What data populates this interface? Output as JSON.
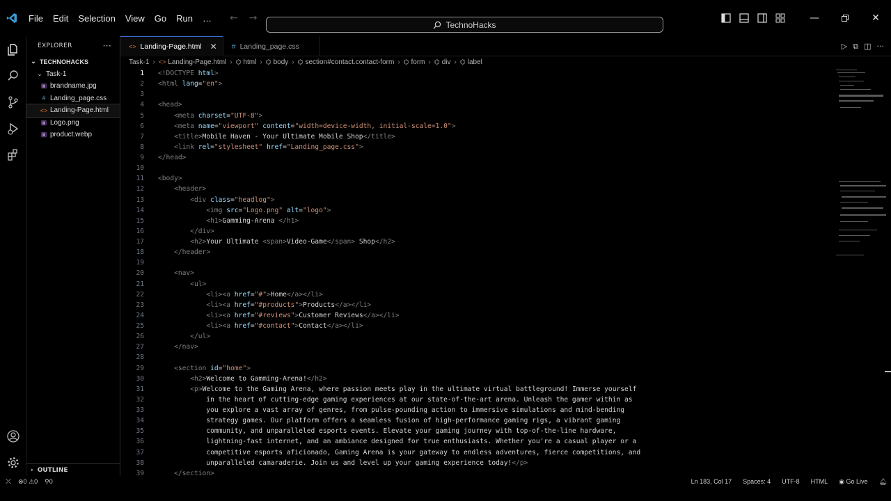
{
  "titlebar": {
    "menu": [
      "File",
      "Edit",
      "Selection",
      "View",
      "Go",
      "Run",
      "…"
    ],
    "search_text": "TechnoHacks"
  },
  "sidebar": {
    "header": "EXPLORER",
    "root": "TECHNOHACKS",
    "folder": "Task-1",
    "files": [
      {
        "name": "brandname.jpg",
        "icon": "image-icon"
      },
      {
        "name": "Landing_page.css",
        "icon": "css-icon"
      },
      {
        "name": "Landing-Page.html",
        "icon": "html-icon",
        "selected": true
      },
      {
        "name": "Logo.png",
        "icon": "image-icon"
      },
      {
        "name": "product.webp",
        "icon": "image-icon"
      }
    ],
    "outline_label": "OUTLINE"
  },
  "tabs": [
    {
      "label": "Landing-Page.html",
      "active": true
    },
    {
      "label": "Landing_page.css",
      "active": false
    }
  ],
  "breadcrumbs": [
    "Task-1",
    "Landing-Page.html",
    "html",
    "body",
    "section#contact.contact-form",
    "form",
    "div",
    "label"
  ],
  "code_lines": [
    {
      "n": "1",
      "text": "<!DOCTYPE html>"
    },
    {
      "n": "2",
      "text": "<html lang=\"en\">"
    },
    {
      "n": "3",
      "text": ""
    },
    {
      "n": "4",
      "text": "<head>"
    },
    {
      "n": "5",
      "text": "    <meta charset=\"UTF-8\">"
    },
    {
      "n": "6",
      "text": "    <meta name=\"viewport\" content=\"width=device-width, initial-scale=1.0\">"
    },
    {
      "n": "7",
      "text": "    <title>Mobile Haven - Your Ultimate Mobile Shop</title>"
    },
    {
      "n": "8",
      "text": "    <link rel=\"stylesheet\" href=\"Landing_page.css\">"
    },
    {
      "n": "9",
      "text": "</head>"
    },
    {
      "n": "10",
      "text": ""
    },
    {
      "n": "11",
      "text": "<body>"
    },
    {
      "n": "12",
      "text": "    <header>"
    },
    {
      "n": "13",
      "text": "        <div class=\"headlog\">"
    },
    {
      "n": "14",
      "text": "            <img src=\"Logo.png\" alt=\"logo\">"
    },
    {
      "n": "15",
      "text": "            <h1>Gamming-Arena </h1>"
    },
    {
      "n": "16",
      "text": "        </div>"
    },
    {
      "n": "17",
      "text": "        <h2>Your Ultimate <span>Video-Game</span> Shop</h2>"
    },
    {
      "n": "18",
      "text": "    </header>"
    },
    {
      "n": "19",
      "text": ""
    },
    {
      "n": "20",
      "text": "    <nav>"
    },
    {
      "n": "21",
      "text": "        <ul>"
    },
    {
      "n": "22",
      "text": "            <li><a href=\"#\">Home</a></li>"
    },
    {
      "n": "23",
      "text": "            <li><a href=\"#products\">Products</a></li>"
    },
    {
      "n": "24",
      "text": "            <li><a href=\"#reviews\">Customer Reviews</a></li>"
    },
    {
      "n": "25",
      "text": "            <li><a href=\"#contact\">Contact</a></li>"
    },
    {
      "n": "26",
      "text": "        </ul>"
    },
    {
      "n": "27",
      "text": "    </nav>"
    },
    {
      "n": "28",
      "text": ""
    },
    {
      "n": "29",
      "text": "    <section id=\"home\">"
    },
    {
      "n": "30",
      "text": "        <h2>Welcome to Gamming-Arena!</h2>"
    },
    {
      "n": "31",
      "text": "        <p>Welcome to the Gaming Arena, where passion meets play in the ultimate virtual battleground! Immerse yourself"
    },
    {
      "n": "32",
      "text": "            in the heart of cutting-edge gaming experiences at our state-of-the-art arena. Unleash the gamer within as"
    },
    {
      "n": "33",
      "text": "            you explore a vast array of genres, from pulse-pounding action to immersive simulations and mind-bending"
    },
    {
      "n": "34",
      "text": "            strategy games. Our platform offers a seamless fusion of high-performance gaming rigs, a vibrant gaming"
    },
    {
      "n": "35",
      "text": "            community, and unparalleled esports events. Elevate your gaming journey with top-of-the-line hardware,"
    },
    {
      "n": "36",
      "text": "            lightning-fast internet, and an ambiance designed for true enthusiasts. Whether you're a casual player or a"
    },
    {
      "n": "37",
      "text": "            competitive esports aficionado, Gaming Arena is your gateway to endless adventures, fierce competitions, and"
    },
    {
      "n": "38",
      "text": "            unparalleled camaraderie. Join us and level up your gaming experience today!</p>"
    },
    {
      "n": "39",
      "text": "    </section>"
    }
  ],
  "status": {
    "errors": "0",
    "warnings": "0",
    "ports": "0",
    "position": "Ln 183, Col 17",
    "spaces": "Spaces: 4",
    "encoding": "UTF-8",
    "language": "HTML",
    "golive": "Go Live"
  },
  "colors": {
    "accent": "#3b6fcf",
    "tag": "#808080",
    "attr": "#9cdcfe",
    "string": "#ce9178",
    "html_icon": "#e37933",
    "css_icon": "#519aba"
  }
}
